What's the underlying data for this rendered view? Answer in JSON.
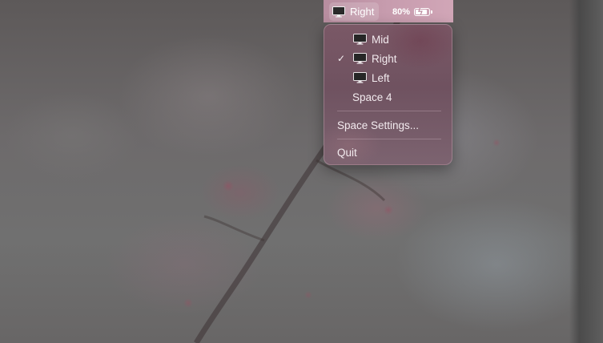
{
  "menubar": {
    "space_label": "Right",
    "battery_percent": "80%",
    "battery_level": 0.8,
    "battery_charging": true
  },
  "menu": {
    "spaces": [
      {
        "label": "Mid",
        "checked": false,
        "icon": "monitor-icon"
      },
      {
        "label": "Right",
        "checked": true,
        "icon": "monitor-icon"
      },
      {
        "label": "Left",
        "checked": false,
        "icon": "monitor-icon"
      },
      {
        "label": "Space 4",
        "checked": false,
        "icon": null
      }
    ],
    "check_mark": "✓",
    "space_settings_label": "Space Settings...",
    "quit_label": "Quit"
  }
}
